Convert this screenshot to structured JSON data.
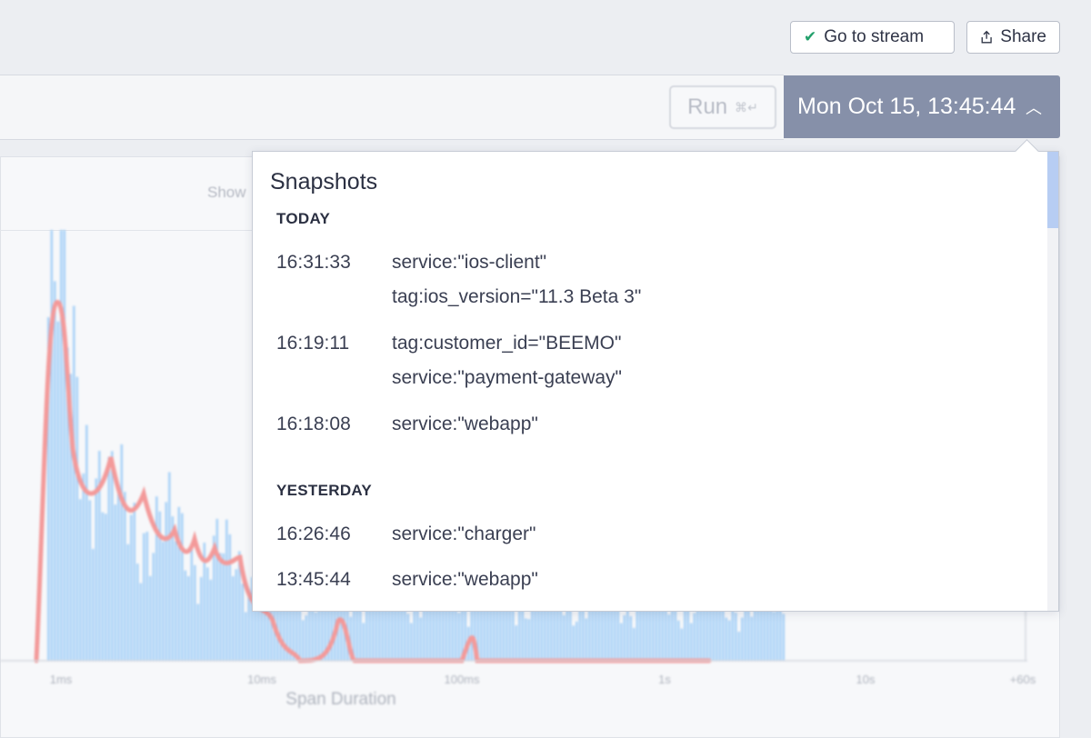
{
  "toolbar": {
    "go_to_stream": "Go to stream",
    "share": "Share"
  },
  "query": {
    "run_label": "Run",
    "run_shortcut": "⌘↵",
    "date_label": "Mon Oct 15, 13:45:44"
  },
  "chart": {
    "show_label": "Show",
    "x_axis_label": "Span Duration",
    "x_ticks": [
      "1ms",
      "10ms",
      "100ms",
      "1s",
      "10s",
      "+60s"
    ]
  },
  "snapshots": {
    "title": "Snapshots",
    "groups": [
      {
        "label": "TODAY",
        "items": [
          {
            "time": "16:31:33",
            "lines": [
              "service:\"ios-client\"",
              "tag:ios_version=\"11.3 Beta 3\""
            ]
          },
          {
            "time": "16:19:11",
            "lines": [
              "tag:customer_id=\"BEEMO\"",
              "service:\"payment-gateway\""
            ]
          },
          {
            "time": "16:18:08",
            "lines": [
              "service:\"webapp\""
            ]
          }
        ]
      },
      {
        "label": "YESTERDAY",
        "items": [
          {
            "time": "16:26:46",
            "lines": [
              "service:\"charger\""
            ]
          },
          {
            "time": "13:45:44",
            "lines": [
              "service:\"webapp\""
            ]
          }
        ]
      }
    ]
  },
  "colors": {
    "bar": "#a9d2f7",
    "curve": "#f39a9a",
    "date_button": "#8690a9",
    "scroll_thumb": "#b7cdf3"
  }
}
